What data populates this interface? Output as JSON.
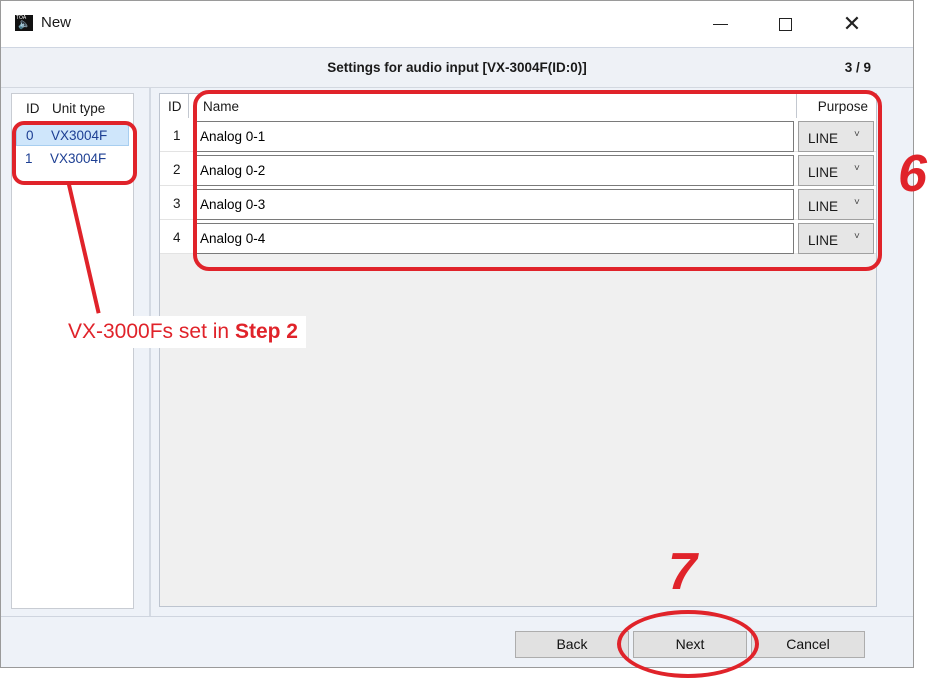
{
  "window": {
    "title": "New",
    "app_icon": "toa-speaker-icon",
    "app_icon_text": "TOA"
  },
  "header": {
    "title": "Settings for audio input [VX-3004F(ID:0)]",
    "step": "3 / 9"
  },
  "unit_list": {
    "columns": {
      "id": "ID",
      "type": "Unit type"
    },
    "rows": [
      {
        "id": "0",
        "type": "VX3004F",
        "selected": true
      },
      {
        "id": "1",
        "type": "VX3004F",
        "selected": false
      }
    ]
  },
  "input_grid": {
    "columns": {
      "id": "ID",
      "name": "Name",
      "purpose": "Purpose"
    },
    "rows": [
      {
        "id": "1",
        "name": "Analog 0-1",
        "purpose": "LINE"
      },
      {
        "id": "2",
        "name": "Analog 0-2",
        "purpose": "LINE"
      },
      {
        "id": "3",
        "name": "Analog 0-3",
        "purpose": "LINE"
      },
      {
        "id": "4",
        "name": "Analog 0-4",
        "purpose": "LINE"
      }
    ]
  },
  "footer": {
    "back_label": "Back",
    "next_label": "Next",
    "cancel_label": "Cancel"
  },
  "annotations": {
    "units_note": "VX-3000Fs set in",
    "units_note_bold": "Step 2",
    "step_6": "6",
    "step_7": "7",
    "color": "#e0232a"
  }
}
